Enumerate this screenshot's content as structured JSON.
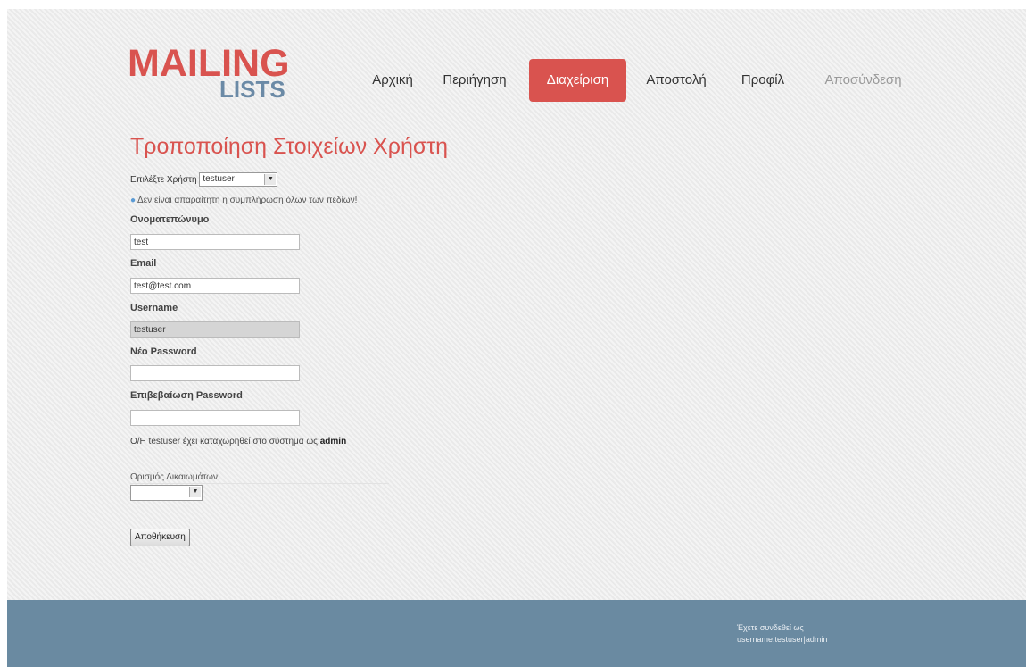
{
  "logo": {
    "line1": "MAILING",
    "line2": "LISTS"
  },
  "nav": {
    "items": [
      {
        "label": "Αρχική"
      },
      {
        "label": "Περιήγηση"
      },
      {
        "label": "Διαχείριση"
      },
      {
        "label": "Αποστολή"
      },
      {
        "label": "Προφίλ"
      },
      {
        "label": "Αποσύνδεση"
      }
    ]
  },
  "page_title": "Τροποποίηση Στοιχείων Χρήστη",
  "user_select": {
    "label": "Επιλέξτε Χρήστη",
    "value": "testuser"
  },
  "note": "Δεν είναι απαραίτητη η συμπλήρωση όλων των πεδίων!",
  "form": {
    "fullname": {
      "label": "Ονοματεπώνυμο",
      "value": "test"
    },
    "email": {
      "label": "Email",
      "value": "test@test.com"
    },
    "username": {
      "label": "Username",
      "value": "testuser"
    },
    "new_password": {
      "label": "Νέο Password",
      "value": ""
    },
    "confirm_password": {
      "label": "Επιβεβαίωση Password",
      "value": ""
    }
  },
  "info": {
    "prefix": "Ο/Η testuser έχει καταχωρηθεί στο σύστημα ως:",
    "role": "admin"
  },
  "rights": {
    "label": "Ορισμός Δικαιωμάτων:",
    "value": ""
  },
  "save_label": "Αποθήκευση",
  "footer": {
    "line1": "Έχετε συνδεθεί ως",
    "line2": "username:testuser|admin"
  },
  "colors": {
    "accent": "#d9534f",
    "logo_secondary": "#6b8aa6",
    "footer_bg": "#6a8aa1"
  },
  "icons": {
    "note": "info-dot-icon",
    "dropdown": "dropdown-arrow-icon"
  }
}
